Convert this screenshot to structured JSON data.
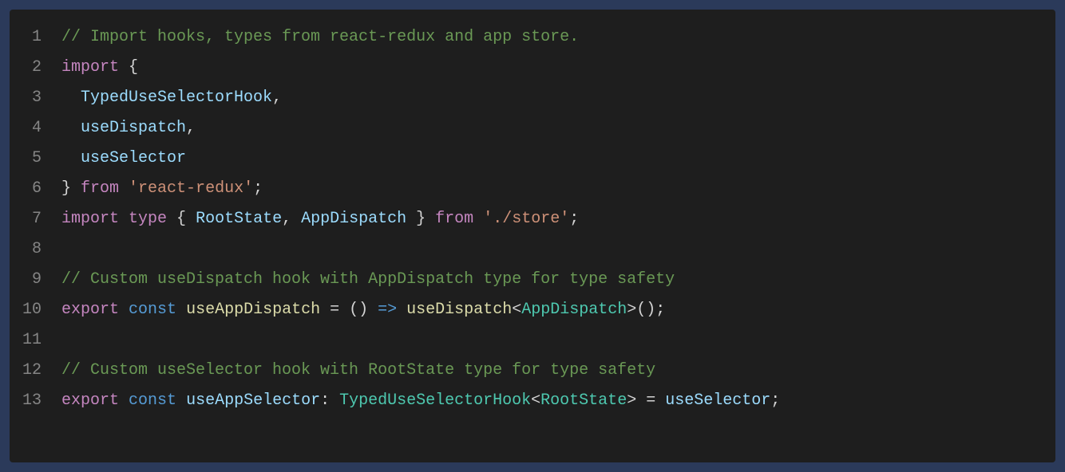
{
  "editor": {
    "lines": [
      {
        "n": "1",
        "tokens": [
          {
            "c": "comment",
            "t": "// Import hooks, types from react-redux and app store."
          }
        ]
      },
      {
        "n": "2",
        "tokens": [
          {
            "c": "keyword",
            "t": "import"
          },
          {
            "c": "punct",
            "t": " {"
          }
        ]
      },
      {
        "n": "3",
        "tokens": [
          {
            "c": "punct",
            "t": "  "
          },
          {
            "c": "variable",
            "t": "TypedUseSelectorHook"
          },
          {
            "c": "punct",
            "t": ","
          }
        ]
      },
      {
        "n": "4",
        "tokens": [
          {
            "c": "punct",
            "t": "  "
          },
          {
            "c": "variable",
            "t": "useDispatch"
          },
          {
            "c": "punct",
            "t": ","
          }
        ]
      },
      {
        "n": "5",
        "tokens": [
          {
            "c": "punct",
            "t": "  "
          },
          {
            "c": "variable",
            "t": "useSelector"
          }
        ]
      },
      {
        "n": "6",
        "tokens": [
          {
            "c": "punct",
            "t": "} "
          },
          {
            "c": "keyword",
            "t": "from"
          },
          {
            "c": "punct",
            "t": " "
          },
          {
            "c": "string",
            "t": "'react-redux'"
          },
          {
            "c": "punct",
            "t": ";"
          }
        ]
      },
      {
        "n": "7",
        "tokens": [
          {
            "c": "keyword",
            "t": "import"
          },
          {
            "c": "punct",
            "t": " "
          },
          {
            "c": "keyword",
            "t": "type"
          },
          {
            "c": "punct",
            "t": " { "
          },
          {
            "c": "variable",
            "t": "RootState"
          },
          {
            "c": "punct",
            "t": ", "
          },
          {
            "c": "variable",
            "t": "AppDispatch"
          },
          {
            "c": "punct",
            "t": " } "
          },
          {
            "c": "keyword",
            "t": "from"
          },
          {
            "c": "punct",
            "t": " "
          },
          {
            "c": "string",
            "t": "'./store'"
          },
          {
            "c": "punct",
            "t": ";"
          }
        ]
      },
      {
        "n": "8",
        "tokens": []
      },
      {
        "n": "9",
        "tokens": [
          {
            "c": "comment",
            "t": "// Custom useDispatch hook with AppDispatch type for type safety"
          }
        ]
      },
      {
        "n": "10",
        "tokens": [
          {
            "c": "keyword",
            "t": "export"
          },
          {
            "c": "punct",
            "t": " "
          },
          {
            "c": "const-kw",
            "t": "const"
          },
          {
            "c": "punct",
            "t": " "
          },
          {
            "c": "func",
            "t": "useAppDispatch"
          },
          {
            "c": "punct",
            "t": " "
          },
          {
            "c": "operator",
            "t": "="
          },
          {
            "c": "punct",
            "t": " () "
          },
          {
            "c": "const-kw",
            "t": "=>"
          },
          {
            "c": "punct",
            "t": " "
          },
          {
            "c": "func",
            "t": "useDispatch"
          },
          {
            "c": "punct",
            "t": "<"
          },
          {
            "c": "type",
            "t": "AppDispatch"
          },
          {
            "c": "punct",
            "t": ">();"
          }
        ]
      },
      {
        "n": "11",
        "tokens": []
      },
      {
        "n": "12",
        "tokens": [
          {
            "c": "comment",
            "t": "// Custom useSelector hook with RootState type for type safety"
          }
        ]
      },
      {
        "n": "13",
        "tokens": [
          {
            "c": "keyword",
            "t": "export"
          },
          {
            "c": "punct",
            "t": " "
          },
          {
            "c": "const-kw",
            "t": "const"
          },
          {
            "c": "punct",
            "t": " "
          },
          {
            "c": "variable",
            "t": "useAppSelector"
          },
          {
            "c": "punct",
            "t": ": "
          },
          {
            "c": "type",
            "t": "TypedUseSelectorHook"
          },
          {
            "c": "punct",
            "t": "<"
          },
          {
            "c": "type",
            "t": "RootState"
          },
          {
            "c": "punct",
            "t": "> "
          },
          {
            "c": "operator",
            "t": "="
          },
          {
            "c": "punct",
            "t": " "
          },
          {
            "c": "variable",
            "t": "useSelector"
          },
          {
            "c": "punct",
            "t": ";"
          }
        ]
      }
    ]
  }
}
